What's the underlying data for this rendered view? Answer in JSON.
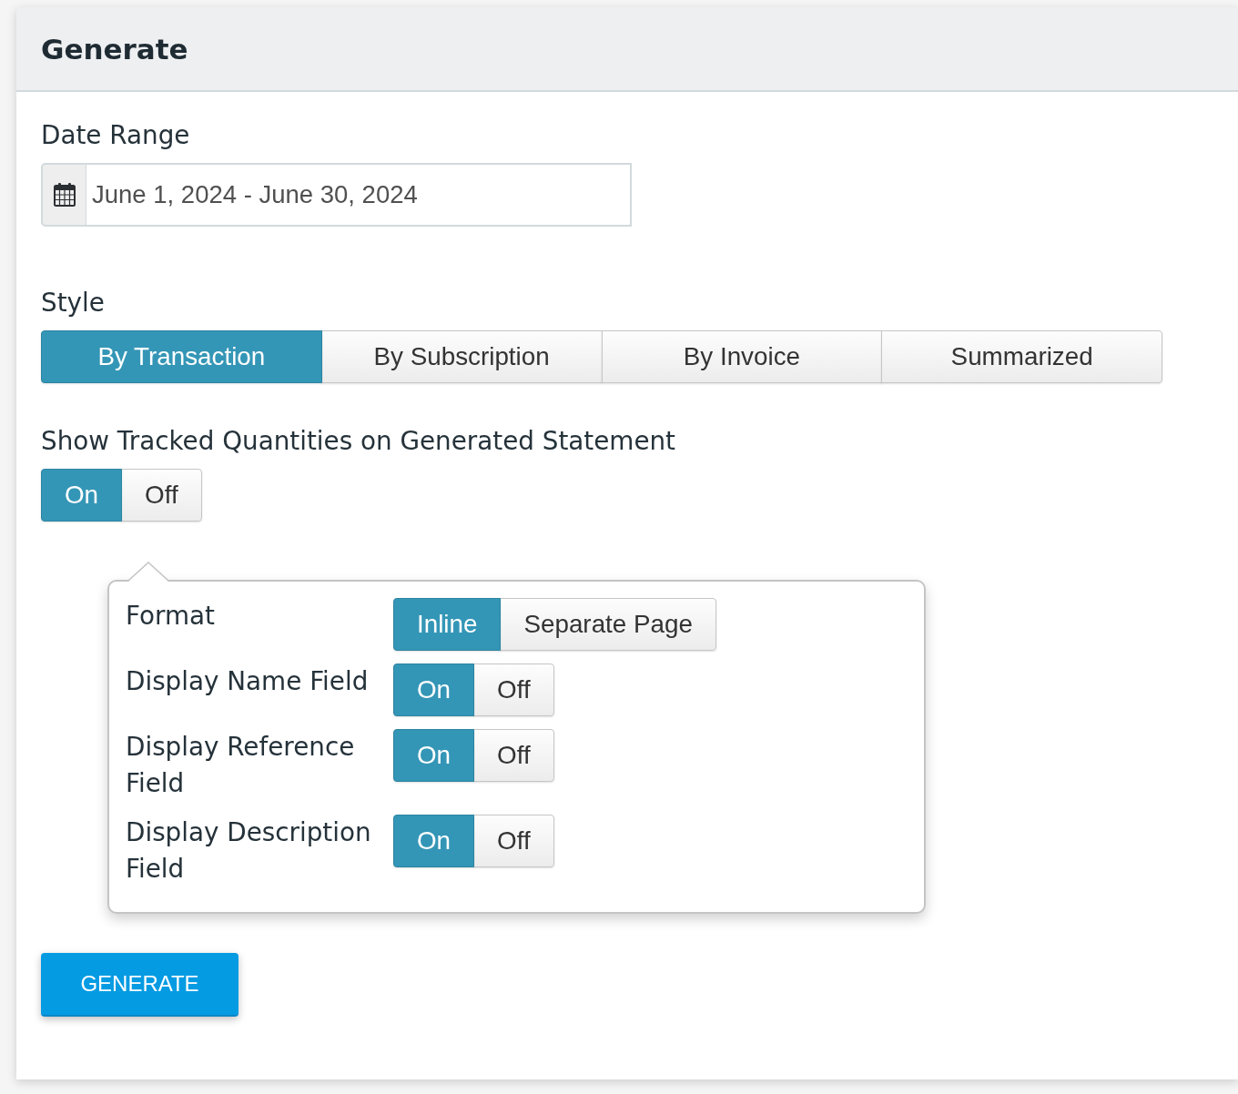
{
  "panel": {
    "title": "Generate"
  },
  "date_range": {
    "label": "Date Range",
    "value": "June 1, 2024 - June 30, 2024"
  },
  "style": {
    "label": "Style",
    "options": [
      {
        "label": "By Transaction",
        "selected": true
      },
      {
        "label": "By Subscription",
        "selected": false
      },
      {
        "label": "By Invoice",
        "selected": false
      },
      {
        "label": "Summarized",
        "selected": false
      }
    ]
  },
  "show_tracked": {
    "label": "Show Tracked Quantities on Generated Statement",
    "options": [
      {
        "label": "On",
        "selected": true
      },
      {
        "label": "Off",
        "selected": false
      }
    ]
  },
  "tracked_settings": {
    "rows": [
      {
        "label": "Format",
        "options": [
          {
            "label": "Inline",
            "selected": true
          },
          {
            "label": "Separate Page",
            "selected": false
          }
        ]
      },
      {
        "label": "Display Name Field",
        "options": [
          {
            "label": "On",
            "selected": true
          },
          {
            "label": "Off",
            "selected": false
          }
        ]
      },
      {
        "label": "Display Reference Field",
        "options": [
          {
            "label": "On",
            "selected": true
          },
          {
            "label": "Off",
            "selected": false
          }
        ]
      },
      {
        "label": "Display Description Field",
        "options": [
          {
            "label": "On",
            "selected": true
          },
          {
            "label": "Off",
            "selected": false
          }
        ]
      }
    ]
  },
  "generate_button": {
    "label": "GENERATE"
  }
}
